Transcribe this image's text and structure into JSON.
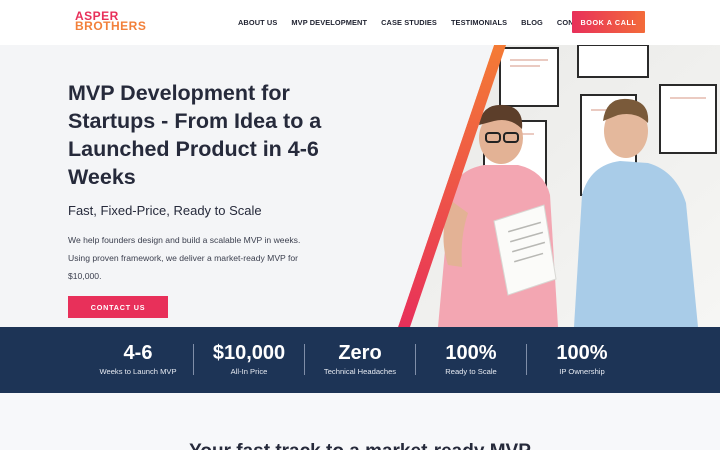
{
  "logo": {
    "line1": "ASPER",
    "line2": "BROTHERS"
  },
  "nav": {
    "items": [
      "ABOUT US",
      "MVP DEVELOPMENT",
      "CASE STUDIES",
      "TESTIMONIALS",
      "BLOG",
      "CONTACT"
    ],
    "cta": "BOOK A CALL"
  },
  "hero": {
    "title": "MVP Development for Startups - From Idea to a Launched Product in 4-6 Weeks",
    "subtitle": "Fast, Fixed-Price, Ready to Scale",
    "description": "We help founders design and build a scalable MVP in weeks. Using proven framework, we deliver a market-ready MVP for $10,000.",
    "button": "CONTACT US"
  },
  "stats": [
    {
      "value": "4-6",
      "label": "Weeks to Launch MVP"
    },
    {
      "value": "$10,000",
      "label": "All-In Price"
    },
    {
      "value": "Zero",
      "label": "Technical Headaches"
    },
    {
      "value": "100%",
      "label": "Ready to Scale"
    },
    {
      "value": "100%",
      "label": "IP Ownership"
    }
  ],
  "section": {
    "title": "Your fast track to a market-ready MVP"
  },
  "colors": {
    "brand_pink": "#e8305a",
    "brand_orange": "#f2803a",
    "navy": "#1d3456"
  }
}
